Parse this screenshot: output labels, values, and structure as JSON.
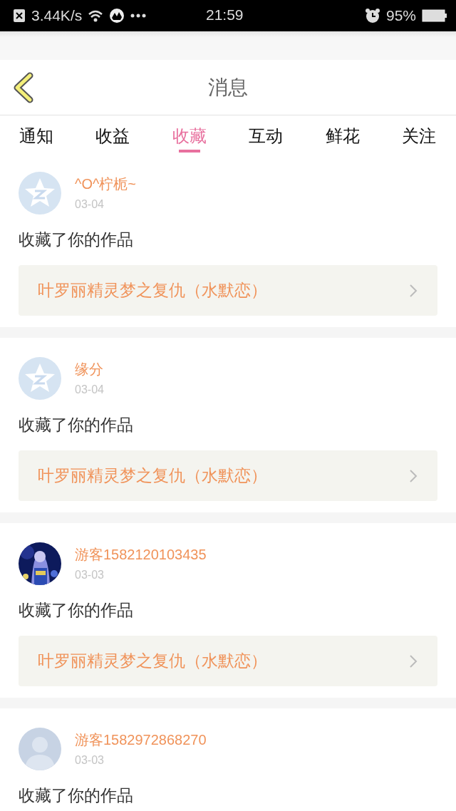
{
  "status_bar": {
    "speed": "3.44K/s",
    "time": "21:59",
    "battery": "95%"
  },
  "header": {
    "title": "消息"
  },
  "tabs": [
    {
      "label": "通知",
      "selected": false
    },
    {
      "label": "收益",
      "selected": false
    },
    {
      "label": "收藏",
      "selected": true
    },
    {
      "label": "互动",
      "selected": false
    },
    {
      "label": "鲜花",
      "selected": false
    },
    {
      "label": "关注",
      "selected": false
    }
  ],
  "messages": [
    {
      "kind": "default",
      "user": "^O^柠栀~",
      "date": "03-04",
      "action": "收藏了你的作品",
      "work": "叶罗丽精灵梦之复仇（水默恋）"
    },
    {
      "kind": "default",
      "user": "缘分",
      "date": "03-04",
      "action": "收藏了你的作品",
      "work": "叶罗丽精灵梦之复仇（水默恋）"
    },
    {
      "kind": "picture",
      "user": "游客1582120103435",
      "date": "03-03",
      "action": "收藏了你的作品",
      "work": "叶罗丽精灵梦之复仇（水默恋）"
    },
    {
      "kind": "silhouette",
      "user": "游客1582972868270",
      "date": "03-03",
      "action": "收藏了你的作品"
    }
  ]
}
